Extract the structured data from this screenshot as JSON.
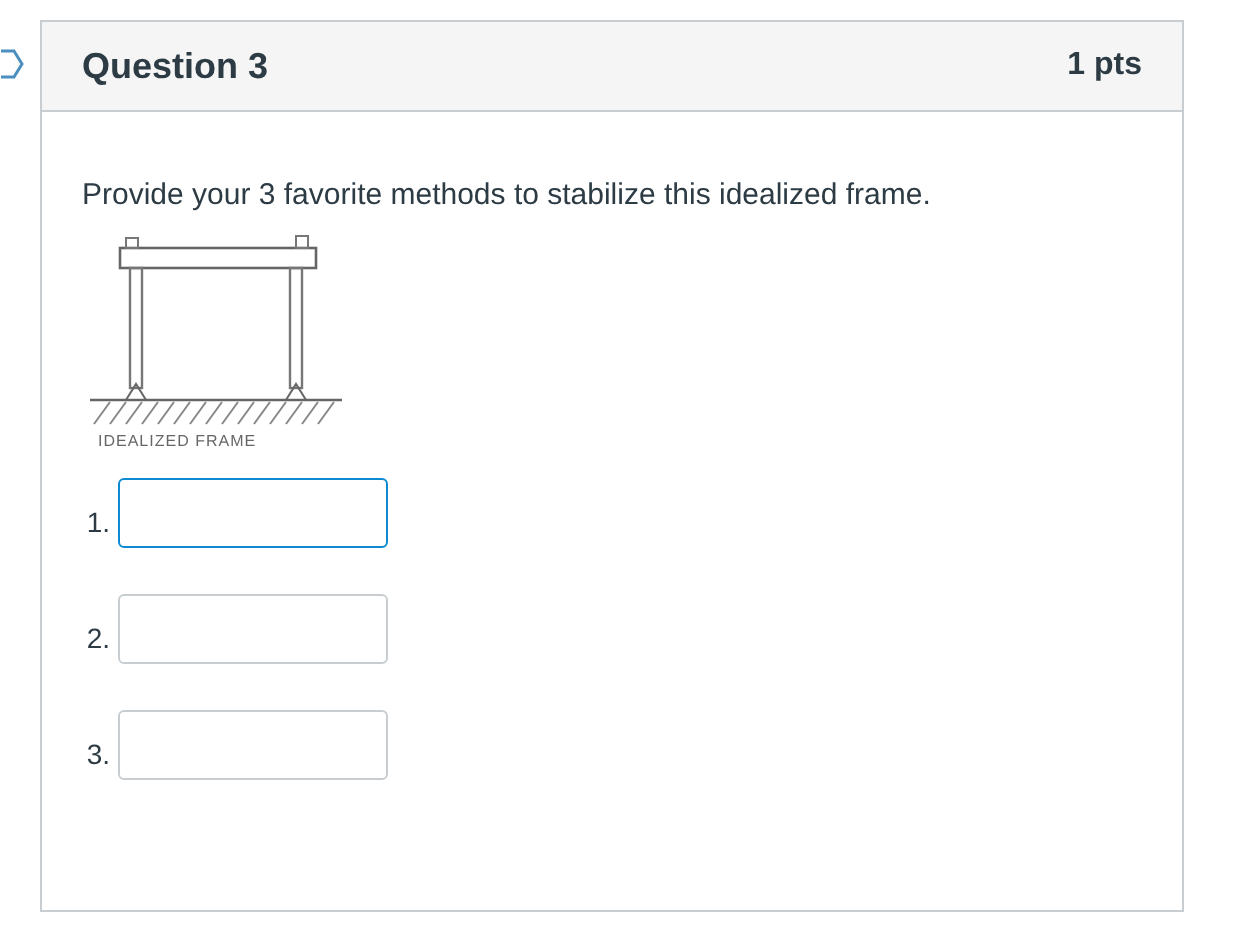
{
  "question": {
    "title": "Question 3",
    "points": "1 pts"
  },
  "prompt": "Provide your 3 favorite methods to stabilize this idealized frame.",
  "figure": {
    "kind": "picture",
    "caption": "IDEALIZED FRAME"
  },
  "answers": [
    {
      "number": "1.",
      "focused": true
    },
    {
      "number": "2.",
      "focused": false
    },
    {
      "number": "3.",
      "focused": false
    }
  ]
}
